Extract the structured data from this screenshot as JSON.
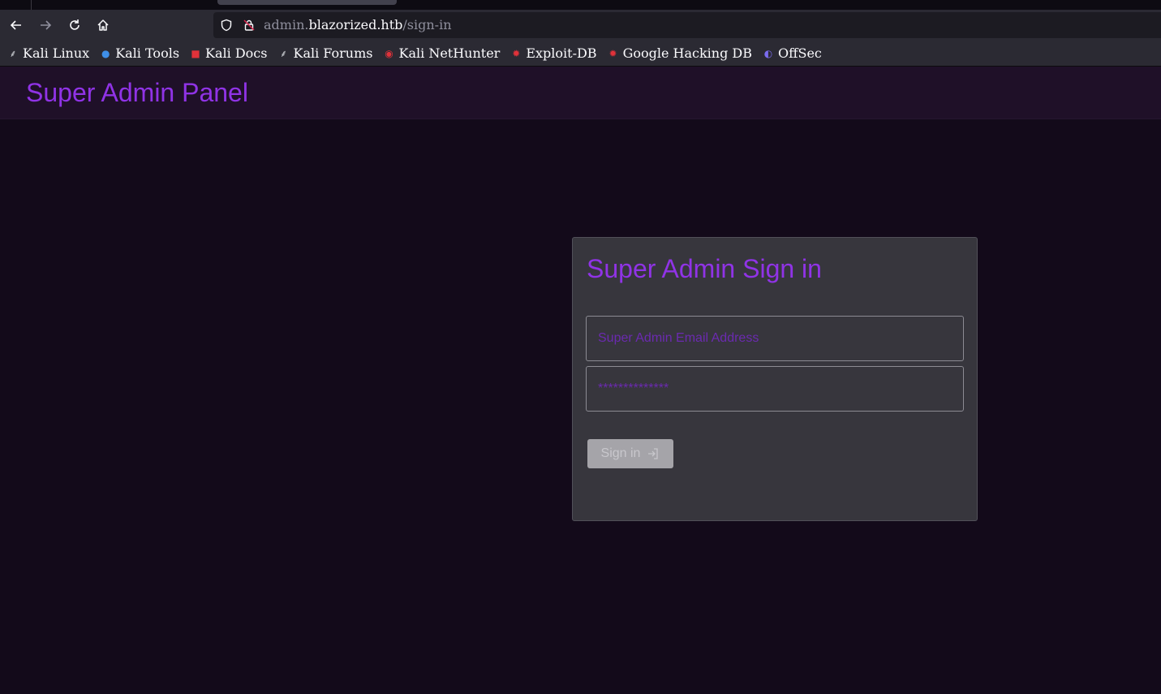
{
  "browser": {
    "url_prefix": "admin.",
    "url_domain": "blazorized.htb",
    "url_path": "/sign-in",
    "bookmarks": [
      {
        "label": "Kali Linux",
        "icon": "kali-dragon-icon"
      },
      {
        "label": "Kali Tools",
        "icon": "kali-tools-icon"
      },
      {
        "label": "Kali Docs",
        "icon": "kali-docs-icon"
      },
      {
        "label": "Kali Forums",
        "icon": "kali-dragon-icon"
      },
      {
        "label": "Kali NetHunter",
        "icon": "nethunter-icon"
      },
      {
        "label": "Exploit-DB",
        "icon": "exploit-db-icon"
      },
      {
        "label": "Google Hacking DB",
        "icon": "ghdb-icon"
      },
      {
        "label": "OffSec",
        "icon": "offsec-icon"
      }
    ]
  },
  "app": {
    "title": "Super Admin Panel"
  },
  "signin": {
    "title": "Super Admin Sign in",
    "email_placeholder": "Super Admin Email Address",
    "password_placeholder": "**************",
    "button_label": "Sign in"
  },
  "colors": {
    "accent": "#9033e6",
    "page_bg": "#130a1a",
    "header_bg": "#1f1028",
    "card_bg": "#37363d"
  }
}
